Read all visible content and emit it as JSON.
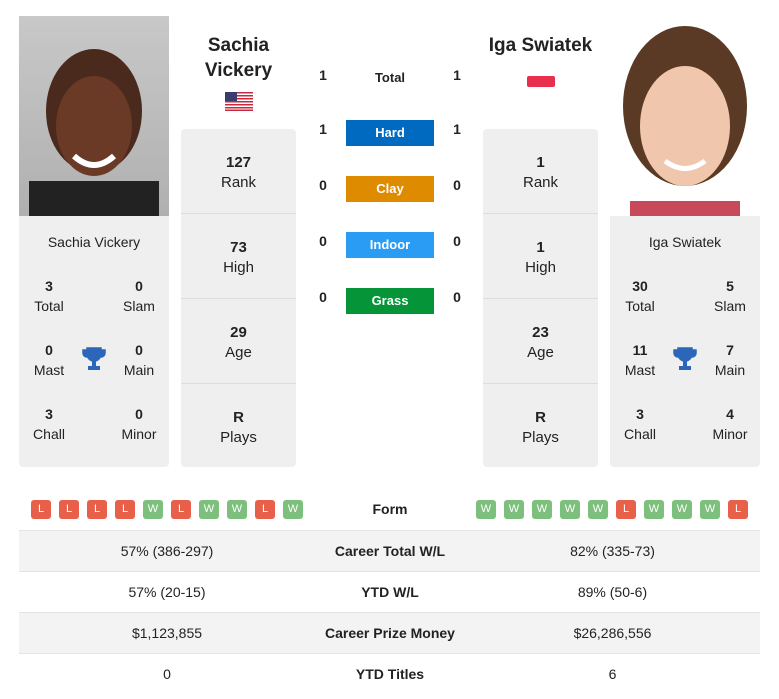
{
  "left": {
    "name": "Sachia Vickery",
    "name_line1": "Sachia",
    "name_line2": "Vickery",
    "country": "USA",
    "stats": {
      "total": "3",
      "slam": "0",
      "mast": "0",
      "main": "0",
      "chall": "3",
      "minor": "0"
    },
    "rank": "127",
    "high": "73",
    "age": "29",
    "plays": "R",
    "form": [
      "L",
      "L",
      "L",
      "L",
      "W",
      "L",
      "W",
      "W",
      "L",
      "W"
    ]
  },
  "right": {
    "name": "Iga Swiatek",
    "country": "Poland",
    "stats": {
      "total": "30",
      "slam": "5",
      "mast": "11",
      "main": "7",
      "chall": "3",
      "minor": "4"
    },
    "rank": "1",
    "high": "1",
    "age": "23",
    "plays": "R",
    "form": [
      "W",
      "W",
      "W",
      "W",
      "W",
      "L",
      "W",
      "W",
      "W",
      "L"
    ]
  },
  "labels": {
    "total": "Total",
    "slam": "Slam",
    "mast": "Mast",
    "main": "Main",
    "chall": "Chall",
    "minor": "Minor",
    "rank": "Rank",
    "high": "High",
    "age": "Age",
    "plays": "Plays",
    "form": "Form"
  },
  "h2h": [
    {
      "label": "Total",
      "left": "1",
      "right": "1",
      "color": ""
    },
    {
      "label": "Hard",
      "left": "1",
      "right": "1",
      "color": "#0069c0"
    },
    {
      "label": "Clay",
      "left": "0",
      "right": "0",
      "color": "#de8b00"
    },
    {
      "label": "Indoor",
      "left": "0",
      "right": "0",
      "color": "#2a9cf4"
    },
    {
      "label": "Grass",
      "left": "0",
      "right": "0",
      "color": "#059438"
    }
  ],
  "colors": {
    "win": "#7dbf7d",
    "loss": "#e8604a",
    "trophy": "#2c66b8"
  },
  "table": [
    {
      "label": "Career Total W/L",
      "left": "57% (386-297)",
      "right": "82% (335-73)"
    },
    {
      "label": "YTD W/L",
      "left": "57% (20-15)",
      "right": "89% (50-6)"
    },
    {
      "label": "Career Prize Money",
      "left": "$1,123,855",
      "right": "$26,286,556"
    },
    {
      "label": "YTD Titles",
      "left": "0",
      "right": "6"
    }
  ]
}
